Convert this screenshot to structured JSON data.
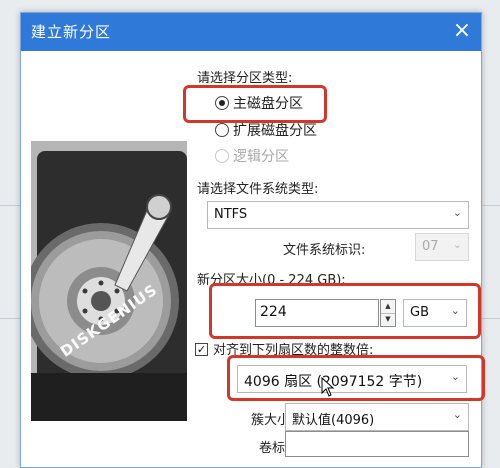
{
  "dialog": {
    "title": "建立新分区",
    "close_glyph": "×"
  },
  "partition_type": {
    "label": "请选择分区类型:",
    "options": [
      {
        "label": "主磁盘分区",
        "selected": true,
        "disabled": false
      },
      {
        "label": "扩展磁盘分区",
        "selected": false,
        "disabled": false
      },
      {
        "label": "逻辑分区",
        "selected": false,
        "disabled": true
      }
    ]
  },
  "file_system": {
    "label": "请选择文件系统类型:",
    "value": "NTFS",
    "id_label": "文件系统标识:",
    "id_value": "07"
  },
  "size": {
    "label": "新分区大小(0 - 224 GB):",
    "value": "224",
    "unit": "GB"
  },
  "align": {
    "checked": true,
    "label": "对齐到下列扇区数的整数倍:",
    "value": "4096 扇区 (2097152 字节)"
  },
  "cluster": {
    "label": "簇大小:",
    "value": "默认值(4096)"
  },
  "volume": {
    "label": "卷标:",
    "value": ""
  },
  "banner": {
    "brand": "DISKGENIUS"
  },
  "colors": {
    "titlebar": "#2f79d8",
    "highlight": "#d2372a"
  }
}
